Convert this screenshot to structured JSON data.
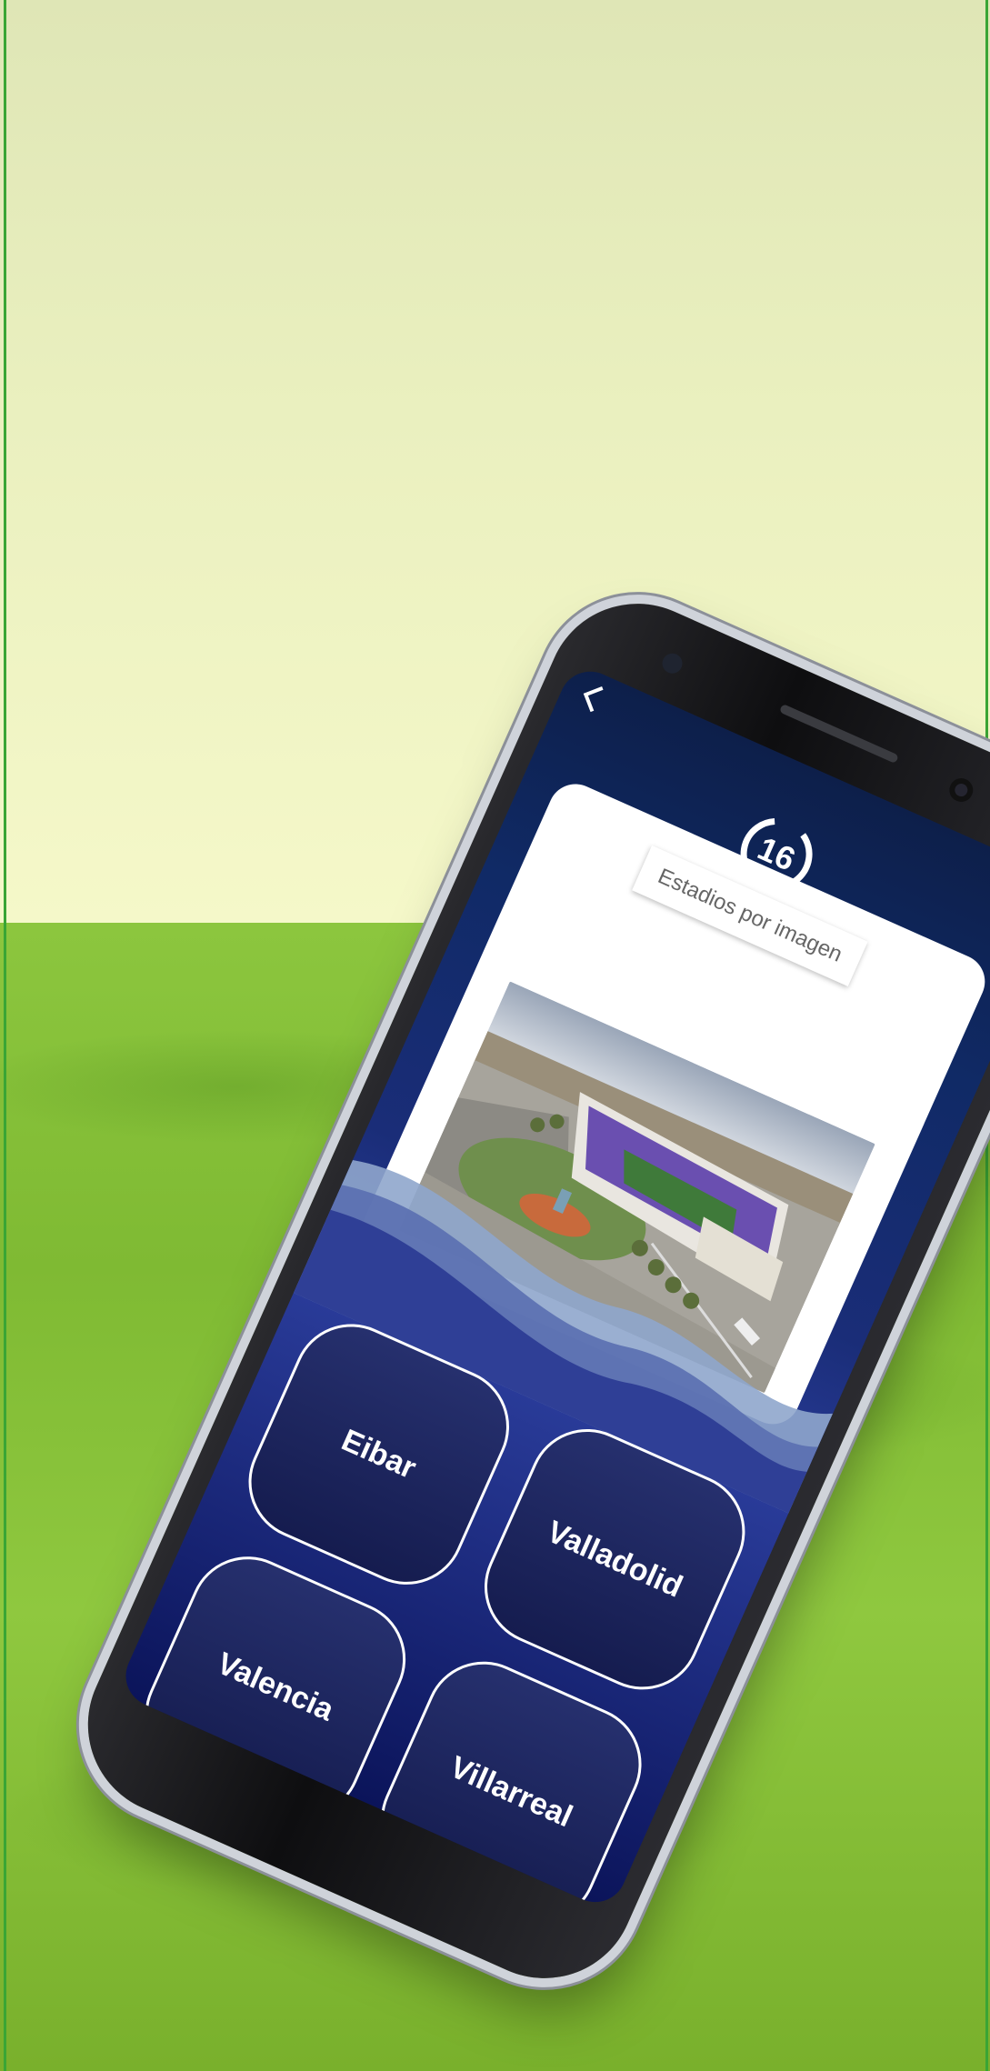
{
  "quiz": {
    "timer": "16",
    "category": "Estadios por imagen",
    "answers": [
      "Eibar",
      "Valladolid",
      "Valencia",
      "Villarreal"
    ]
  },
  "icons": {
    "back": "chevron-left-icon"
  },
  "colors": {
    "sky": "#eaf0bf",
    "grass": "#7fba33",
    "screen_bg": "#1a2d78",
    "answer_bg": "#1e2660",
    "stadium_seats": "#6a4fb0"
  }
}
